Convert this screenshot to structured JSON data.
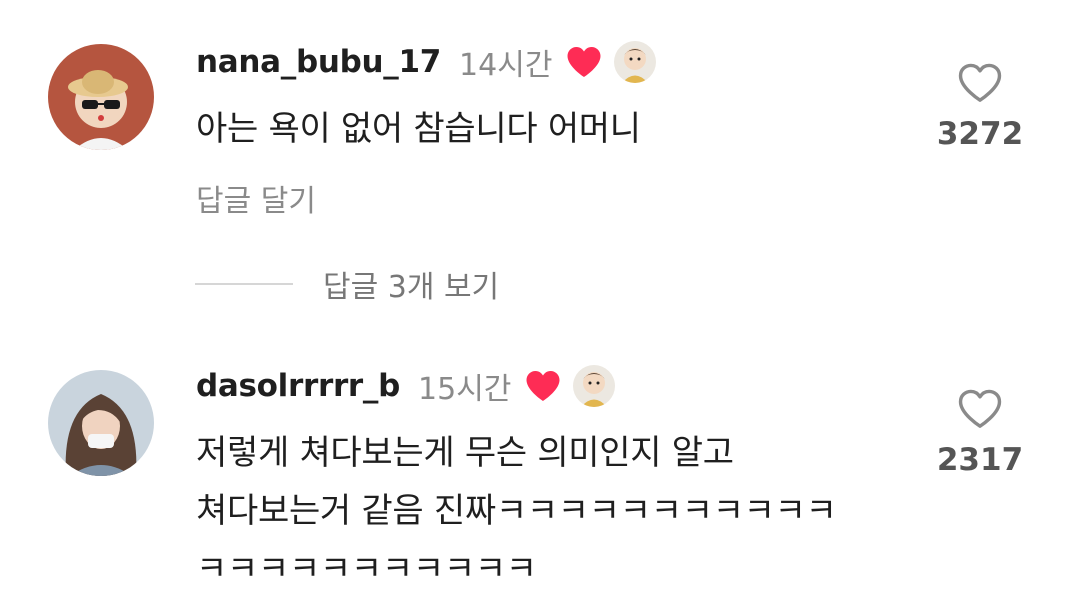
{
  "comments": [
    {
      "username": "nana_bubu_17",
      "time": "14시간",
      "lines": [
        "아는 욕이 없어 참습니다 어머니"
      ],
      "reply_label": "답글 달기",
      "like_count": "3272",
      "creator_liked": true
    },
    {
      "username": "dasolrrrrr_b",
      "time": "15시간",
      "lines": [
        "저렇게 쳐다보는게 무슨 의미인지 알고",
        "쳐다보는거 같음 진짜ㅋㅋㅋㅋㅋㅋㅋㅋㅋㅋㅋ",
        "ㅋㅋㅋㅋㅋㅋㅋㅋㅋㅋㅋ"
      ],
      "like_count": "2317",
      "creator_liked": true
    }
  ],
  "view_replies_label": "답글 3개 보기",
  "icons": {
    "liked_heart": "heart-filled-icon",
    "like_outline": "heart-outline-icon"
  },
  "colors": {
    "heart_red": "#fe2c55",
    "text_primary": "#1f1f1f",
    "text_secondary": "#8a8a8a"
  }
}
